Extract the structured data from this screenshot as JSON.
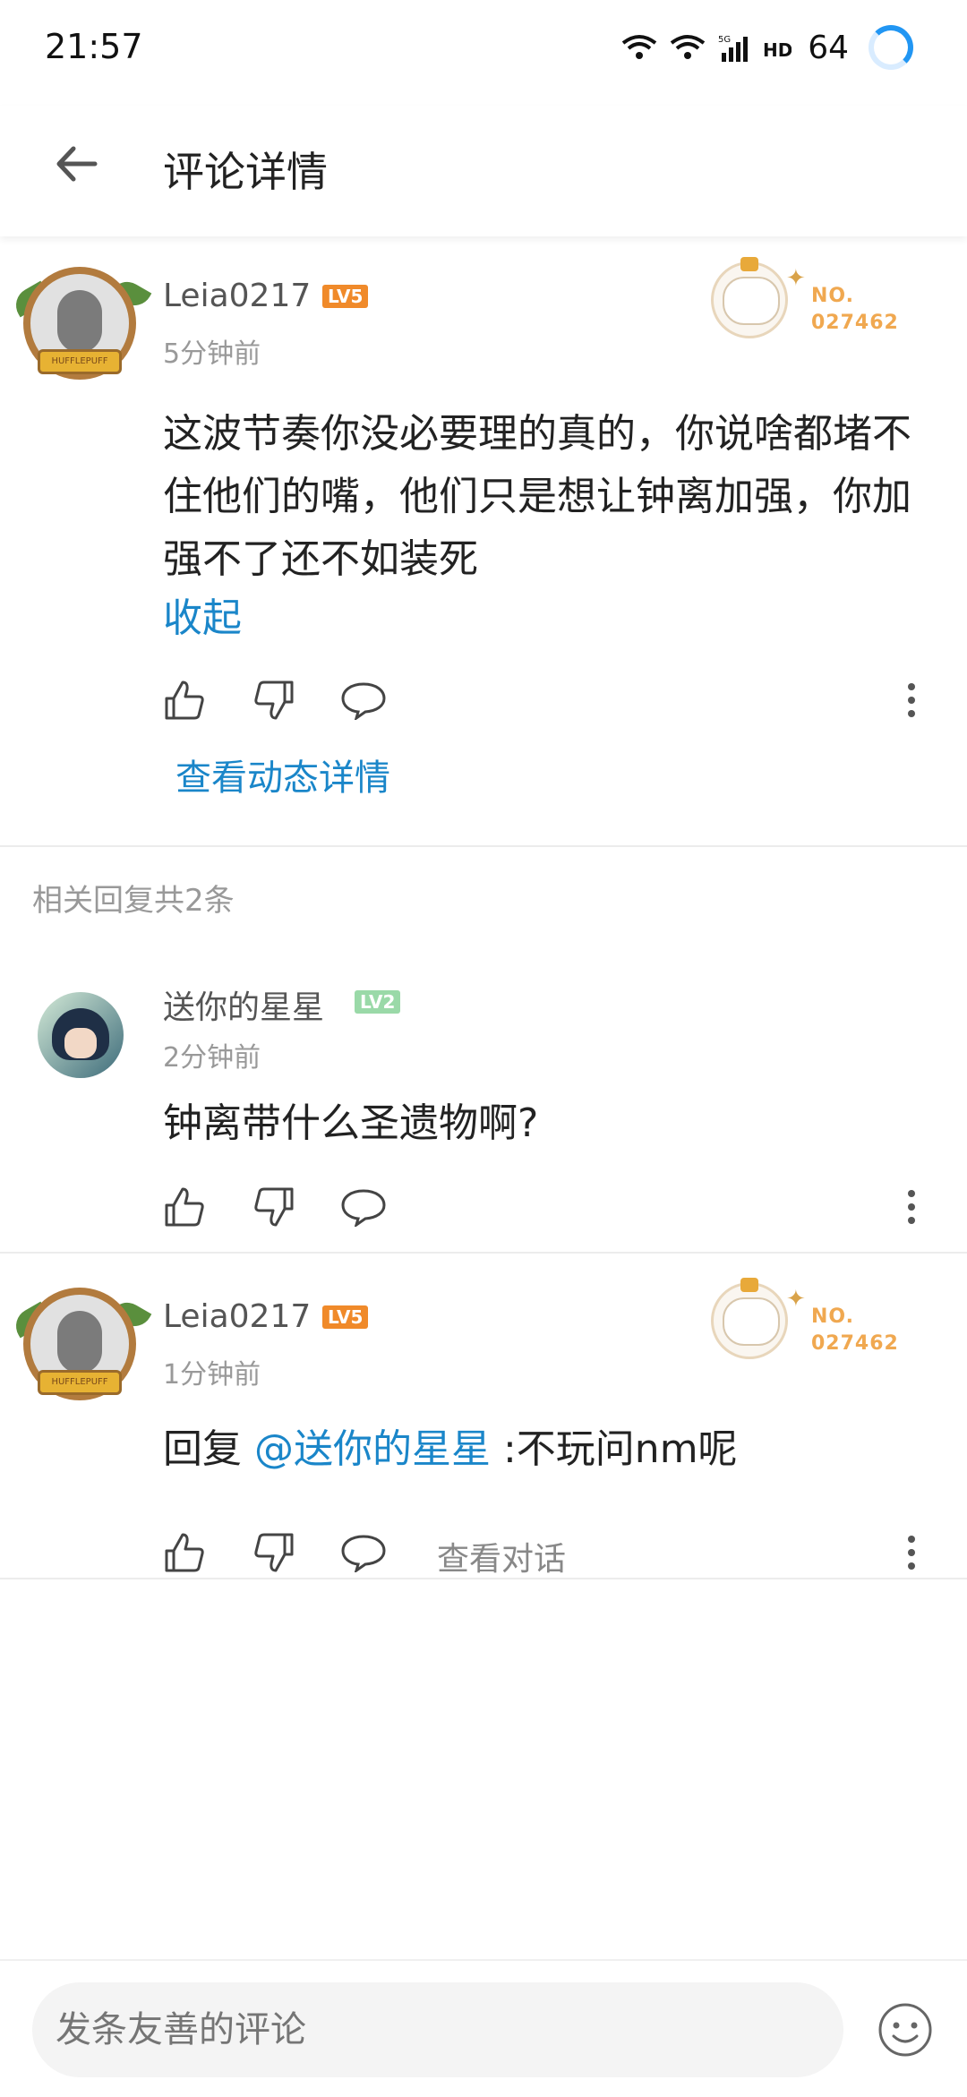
{
  "status_bar": {
    "time": "21:57",
    "battery": "64",
    "network_label": "5G",
    "hd_label": "HD",
    "icons": [
      "wifi-icon",
      "wifi-icon",
      "signal-icon",
      "hd-icon",
      "loading-ring-icon"
    ]
  },
  "header": {
    "title": "评论详情",
    "back_icon": "arrow-left-icon"
  },
  "main_comment": {
    "username": "Leia0217",
    "level": "LV5",
    "time": "5分钟前",
    "text": "这波节奏你没必要理的真的，你说啥都堵不住他们的嘴，他们只是想让钟离加强，你加强不了还不如装死",
    "collapse": "收起",
    "view_detail": "查看动态详情",
    "badge_no_label": "NO.",
    "badge_no_value": "027462",
    "avatar_banner": "HUFFLEPUFF"
  },
  "replies_header": "相关回复共2条",
  "replies": [
    {
      "username": "送你的星星",
      "level": "LV2",
      "time": "2分钟前",
      "text": "钟离带什么圣遗物啊?"
    },
    {
      "username": "Leia0217",
      "level": "LV5",
      "time": "1分钟前",
      "reply_prefix": "回复 ",
      "mention": "@送你的星星",
      "text": " :不玩问nm呢",
      "view_conversation": "查看对话",
      "badge_no_label": "NO.",
      "badge_no_value": "027462",
      "avatar_banner": "HUFFLEPUFF"
    }
  ],
  "input": {
    "placeholder": "发条友善的评论"
  },
  "colors": {
    "accent_blue": "#1a86c9",
    "lv5": "#f08a2a",
    "lv2": "#9ad9a8",
    "secondary_text": "#999999"
  }
}
